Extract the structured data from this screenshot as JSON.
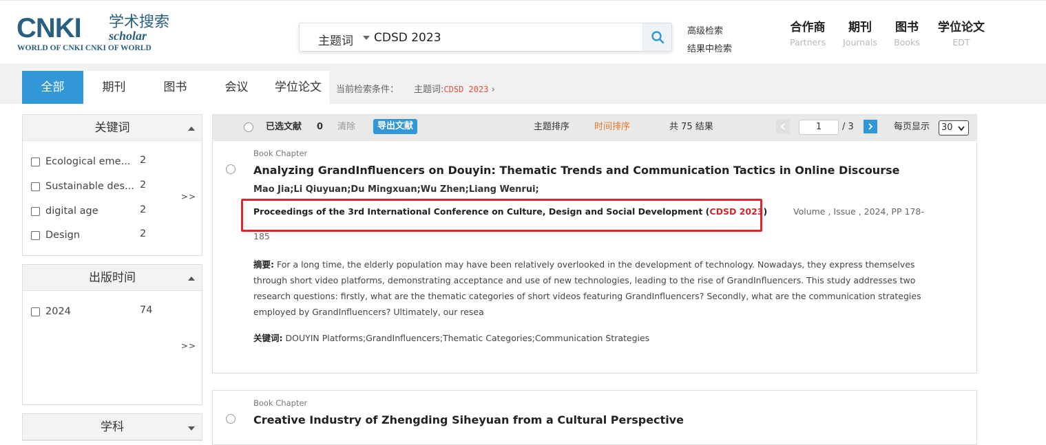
{
  "header": {
    "logo": {
      "main": "CNKI",
      "cn": "学术搜索",
      "scholar": "scholar",
      "sub": "WORLD OF CNKI CNKI OF WORLD"
    },
    "search": {
      "field_label": "主题词",
      "query": "CDSD 2023"
    },
    "adv_search": "高级检索",
    "search_within": "结果中检索",
    "nav": [
      {
        "cn": "合作商",
        "en": "Partners"
      },
      {
        "cn": "期刊",
        "en": "Journals"
      },
      {
        "cn": "图书",
        "en": "Books"
      },
      {
        "cn": "学位论文",
        "en": "EDT"
      }
    ]
  },
  "tabs": [
    "全部",
    "期刊",
    "图书",
    "会议",
    "学位论文"
  ],
  "condition": {
    "label": "当前检索条件：",
    "field": "主题词:",
    "value": "CDSD 2023"
  },
  "facets": {
    "keywords": {
      "title": "关键词",
      "items": [
        {
          "label": "Ecological eme...",
          "count": "2"
        },
        {
          "label": "Sustainable des...",
          "count": "2"
        },
        {
          "label": "digital age",
          "count": "2"
        },
        {
          "label": "Design",
          "count": "2"
        }
      ],
      "more": ">>"
    },
    "year": {
      "title": "出版时间",
      "items": [
        {
          "label": "2024",
          "count": "74"
        }
      ],
      "more": ">>"
    },
    "subject": {
      "title": "学科"
    }
  },
  "toolbar": {
    "selected_label": "已选文献",
    "selected_count": "0",
    "clear": "清除",
    "export": "导出文献",
    "sort_topic": "主题排序",
    "sort_time": "时间排序",
    "total": "共 75 结果",
    "page": "1",
    "page_total": "/ 3",
    "per_page_label": "每页显示",
    "per_page": "30"
  },
  "results": [
    {
      "type": "Book Chapter",
      "title": "Analyzing GrandInfluencers on Douyin: Thematic Trends and Communication Tactics in Online Discourse",
      "authors": "Mao Jia;Li Qiuyuan;Du Mingxuan;Wu Zhen;Liang Wenrui;",
      "source_prefix": "Proceedings of the 3rd International Conference on Culture, Design and Social Development (",
      "source_highlight": "CDSD 2023",
      "source_suffix": ")",
      "volume": "Volume , Issue , 2024, PP 178-",
      "pages_cont": "185",
      "abstract_label": "摘要:",
      "abstract": "For a long time, the elderly population may have been relatively overlooked in the development of technology. Nowadays, they express themselves through short video platforms, demonstrating acceptance and use of new technologies, leading to the rise of GrandInfluencers. This study addresses two research questions: firstly, what are the thematic categories of short videos featuring GrandInfluencers? Secondly, what are the communication strategies employed by GrandInfluencers? Ultimately, our resea",
      "keywords_label": "关键词:",
      "keywords": "DOUYIN Platforms;GrandInfluencers;Thematic Categories;Communication Strategies"
    },
    {
      "type": "Book Chapter",
      "title": "Creative Industry of Zhengding Siheyuan from a Cultural Perspective"
    }
  ]
}
